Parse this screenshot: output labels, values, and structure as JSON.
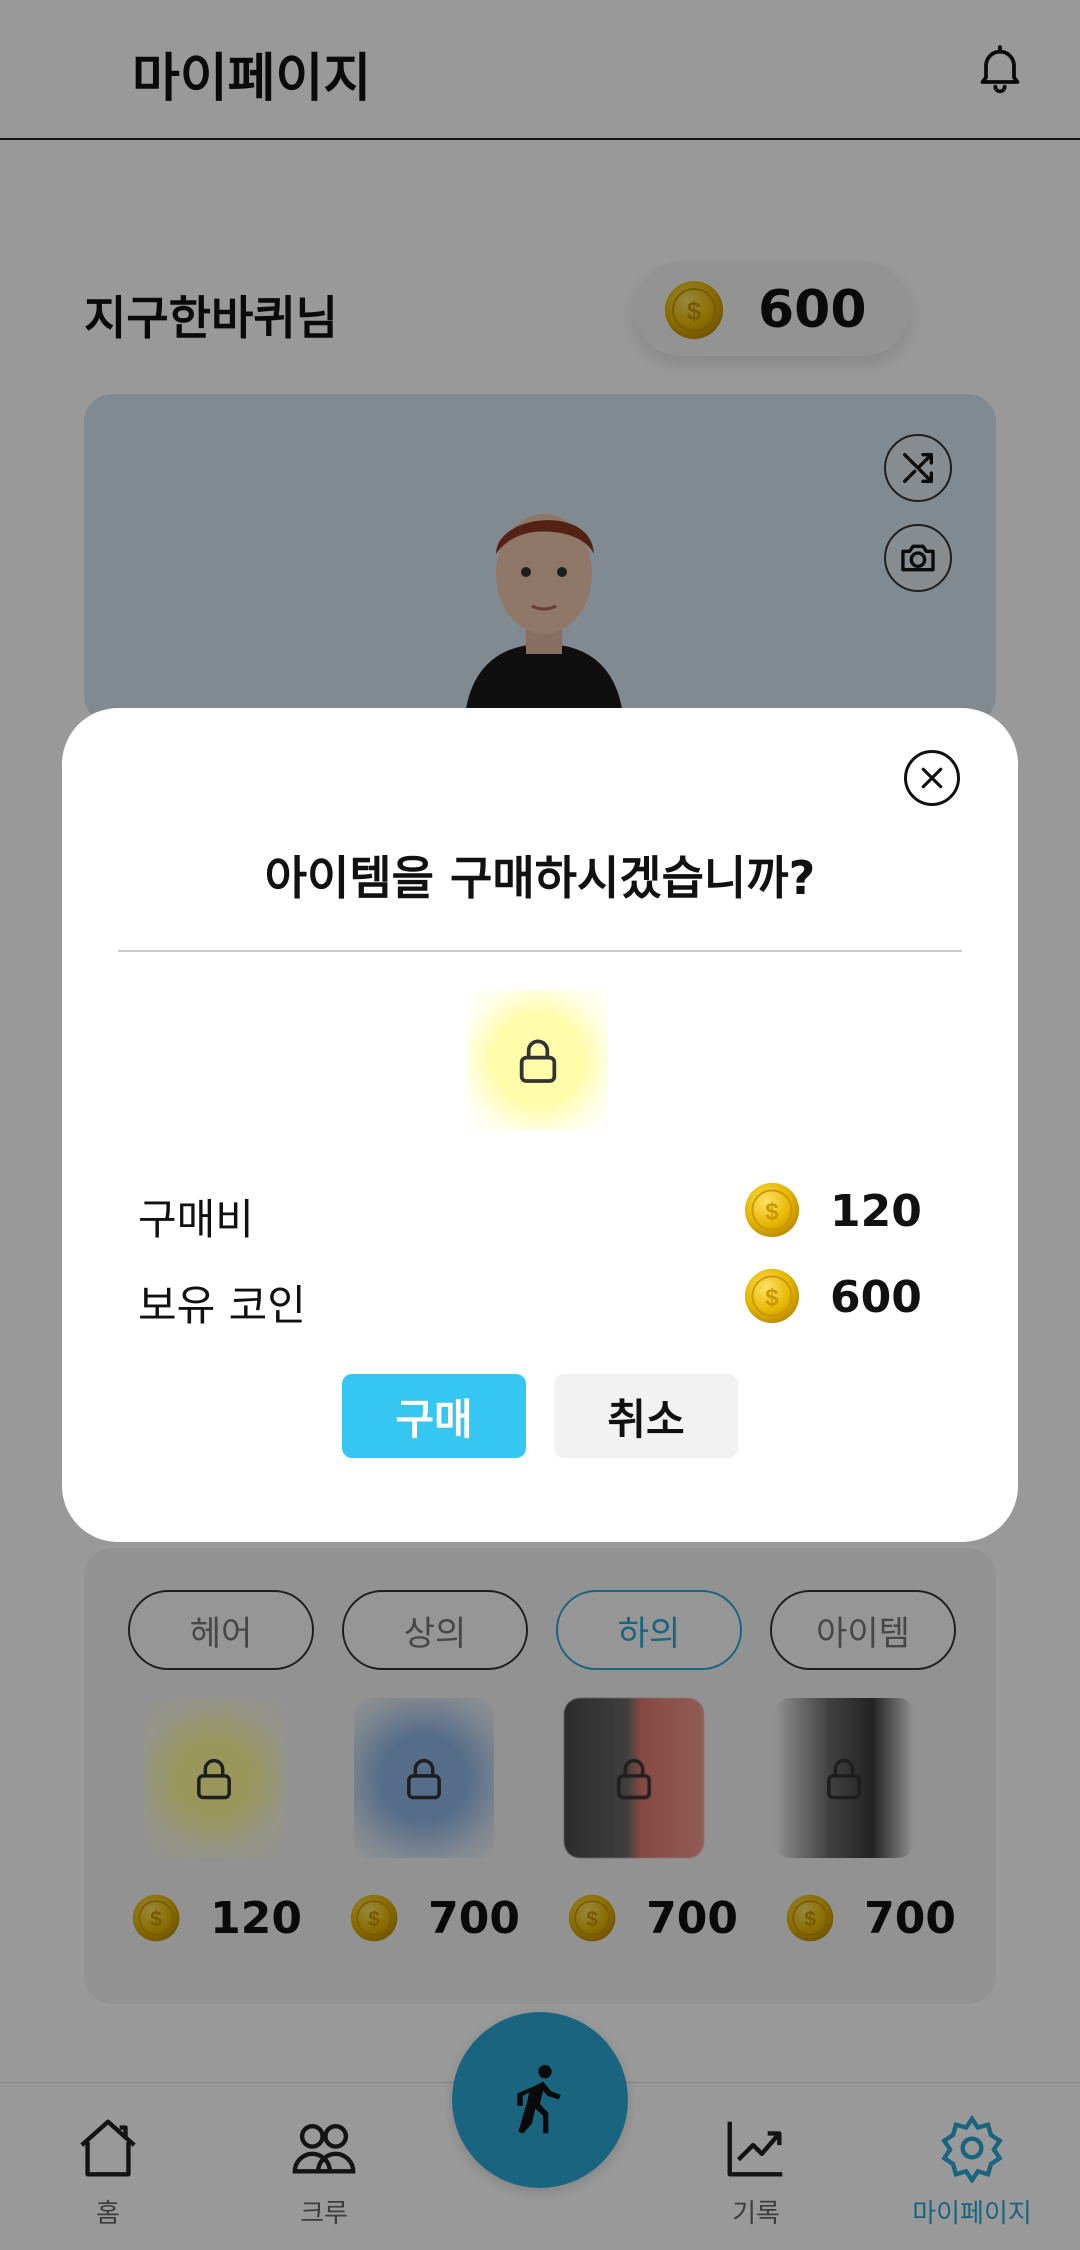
{
  "header": {
    "title": "마이페이지"
  },
  "profile": {
    "nickname": "지구한바퀴님",
    "coins": "600"
  },
  "shop": {
    "tabs": [
      {
        "label": "헤어"
      },
      {
        "label": "상의"
      },
      {
        "label": "하의",
        "active": true
      },
      {
        "label": "아이템"
      }
    ],
    "items": [
      {
        "price": "120",
        "color": "#fffb9a",
        "locked": true
      },
      {
        "price": "700",
        "color": "#8fb6e6",
        "locked": true
      },
      {
        "price": "700",
        "color": "#e07a6e",
        "locked": true
      },
      {
        "price": "700",
        "color": "#3a3a3a",
        "locked": true
      }
    ]
  },
  "nav": {
    "home": "홈",
    "crew": "크루",
    "record": "기록",
    "mypage": "마이페이지"
  },
  "modal": {
    "question": "아이템을 구매하시겠습니까?",
    "cost_label": "구매비",
    "cost_value": "120",
    "owned_label": "보유 코인",
    "owned_value": "600",
    "buy_label": "구매",
    "cancel_label": "취소"
  },
  "colors": {
    "accent": "#2aa8d6",
    "buy_button": "#36c6f2",
    "coin": "#e6b800"
  }
}
